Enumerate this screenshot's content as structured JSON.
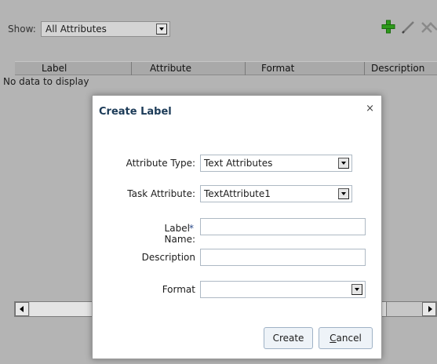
{
  "filter": {
    "label": "Show:",
    "selected": "All Attributes"
  },
  "toolbar": {
    "add_icon": "plus-icon",
    "edit_icon": "pencil-icon",
    "delete_icon": "delete-x-icon",
    "colors": {
      "add": "#2e9a1b",
      "edit": "#7a7a7a"
    }
  },
  "table": {
    "columns": [
      "Label",
      "Attribute",
      "Format",
      "Description"
    ],
    "empty_text": "No data to display"
  },
  "dialog": {
    "title": "Create Label",
    "close_glyph": "×",
    "fields": {
      "attribute_type": {
        "label": "Attribute Type:",
        "value": "Text Attributes"
      },
      "task_attribute": {
        "label": "Task Attribute:",
        "value": "TextAttribute1"
      },
      "label_name": {
        "required_mark": "*",
        "label": "Label Name:",
        "value": ""
      },
      "description": {
        "label": "Description",
        "value": ""
      },
      "format": {
        "label": "Format",
        "value": ""
      }
    },
    "buttons": {
      "create": "Create",
      "cancel_mnemonic": "C",
      "cancel_rest": "ancel"
    }
  }
}
